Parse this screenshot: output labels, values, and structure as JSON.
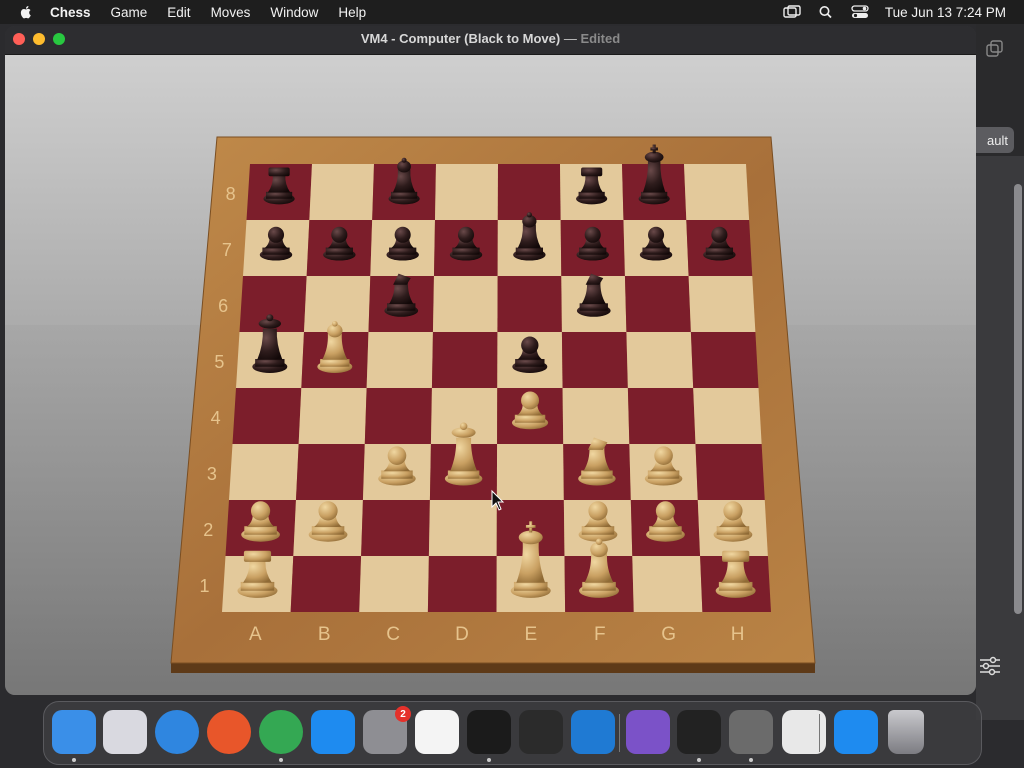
{
  "menubar": {
    "app_name": "Chess",
    "items": [
      "Game",
      "Edit",
      "Moves",
      "Window",
      "Help"
    ],
    "datetime": "Tue Jun 13  7:24 PM"
  },
  "window": {
    "title": "VM4 - Computer  (Black to Move)",
    "separator": "—",
    "status": "Edited"
  },
  "background_window": {
    "button_label": "ault"
  },
  "board": {
    "files": [
      "A",
      "B",
      "C",
      "D",
      "E",
      "F",
      "G",
      "H"
    ],
    "ranks": [
      "1",
      "2",
      "3",
      "4",
      "5",
      "6",
      "7",
      "8"
    ],
    "light_square": "#e3c99b",
    "dark_square": "#7c1e2b",
    "frame_color": "#b27a3e",
    "pieces": [
      {
        "square": "a8",
        "color": "black",
        "type": "rook"
      },
      {
        "square": "c8",
        "color": "black",
        "type": "bishop"
      },
      {
        "square": "f8",
        "color": "black",
        "type": "rook"
      },
      {
        "square": "g8",
        "color": "black",
        "type": "king"
      },
      {
        "square": "a7",
        "color": "black",
        "type": "pawn"
      },
      {
        "square": "b7",
        "color": "black",
        "type": "pawn"
      },
      {
        "square": "c7",
        "color": "black",
        "type": "pawn"
      },
      {
        "square": "d7",
        "color": "black",
        "type": "pawn"
      },
      {
        "square": "e7",
        "color": "black",
        "type": "bishop"
      },
      {
        "square": "f7",
        "color": "black",
        "type": "pawn"
      },
      {
        "square": "g7",
        "color": "black",
        "type": "pawn"
      },
      {
        "square": "h7",
        "color": "black",
        "type": "pawn"
      },
      {
        "square": "c6",
        "color": "black",
        "type": "knight"
      },
      {
        "square": "f6",
        "color": "black",
        "type": "knight"
      },
      {
        "square": "a5",
        "color": "black",
        "type": "queen"
      },
      {
        "square": "e5",
        "color": "black",
        "type": "pawn"
      },
      {
        "square": "b5",
        "color": "white",
        "type": "bishop"
      },
      {
        "square": "e4",
        "color": "white",
        "type": "pawn"
      },
      {
        "square": "c3",
        "color": "white",
        "type": "pawn"
      },
      {
        "square": "d3",
        "color": "white",
        "type": "queen"
      },
      {
        "square": "f3",
        "color": "white",
        "type": "knight"
      },
      {
        "square": "g3",
        "color": "white",
        "type": "pawn"
      },
      {
        "square": "a2",
        "color": "white",
        "type": "pawn"
      },
      {
        "square": "b2",
        "color": "white",
        "type": "pawn"
      },
      {
        "square": "f2",
        "color": "white",
        "type": "pawn"
      },
      {
        "square": "g2",
        "color": "white",
        "type": "pawn"
      },
      {
        "square": "h2",
        "color": "white",
        "type": "pawn"
      },
      {
        "square": "a1",
        "color": "white",
        "type": "rook"
      },
      {
        "square": "e1",
        "color": "white",
        "type": "king"
      },
      {
        "square": "f1",
        "color": "white",
        "type": "bishop"
      },
      {
        "square": "h1",
        "color": "white",
        "type": "rook"
      }
    ]
  },
  "dock": {
    "items": [
      {
        "name": "finder-icon",
        "color": "#3a8fe8",
        "running": true
      },
      {
        "name": "launchpad-icon",
        "color": "#d9d9e0",
        "running": false
      },
      {
        "name": "safari-icon",
        "color": "#2f86e0",
        "running": false
      },
      {
        "name": "firefox-icon",
        "color": "#e8562a",
        "running": false
      },
      {
        "name": "chrome-icon",
        "color": "#34a853",
        "running": true
      },
      {
        "name": "app-store-icon",
        "color": "#1e8bf0",
        "running": false
      },
      {
        "name": "system-settings-icon",
        "color": "#8e8e93",
        "running": false,
        "badge": "2"
      },
      {
        "name": "textedit-icon",
        "color": "#f4f4f4",
        "running": false
      },
      {
        "name": "terminal-icon",
        "color": "#1b1b1b",
        "running": true
      },
      {
        "name": "garageband-icon",
        "color": "#2b2b2b",
        "running": false
      },
      {
        "name": "vscode-icon",
        "color": "#1f7ad3",
        "running": false
      },
      {
        "name": "visual-studio-icon",
        "color": "#7b52c8",
        "running": false
      },
      {
        "name": "piano-icon",
        "color": "#222222",
        "running": true
      },
      {
        "name": "chess-icon",
        "color": "#6b6b6b",
        "running": true
      },
      {
        "name": "chrome-window-icon",
        "color": "#e8e8e8",
        "running": false
      },
      {
        "name": "app-store-download-icon",
        "color": "#1e8bf0",
        "running": false
      },
      {
        "name": "trash-icon",
        "color": "#9a9aa0",
        "running": false
      }
    ]
  }
}
